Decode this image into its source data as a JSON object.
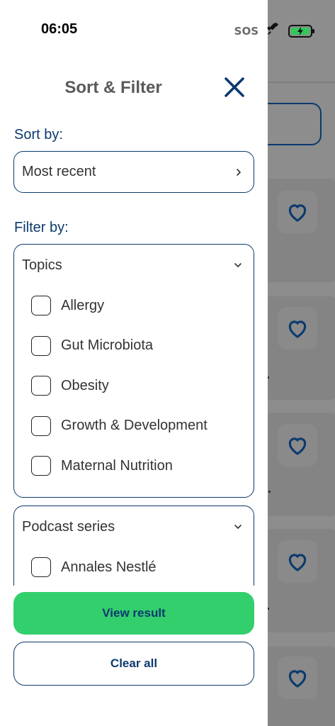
{
  "status_bar": {
    "time": "06:05",
    "sos": "SOS",
    "icons": [
      "satellite-icon",
      "battery-charging-icon"
    ]
  },
  "drawer": {
    "title": "Sort & Filter",
    "close_icon": "close-icon",
    "sort_label": "Sort by:",
    "sort_value": "Most recent",
    "filter_label": "Filter by:",
    "groups": [
      {
        "title": "Topics",
        "options": [
          "Allergy",
          "Gut Microbiota",
          "Obesity",
          "Growth & Development",
          "Maternal Nutrition"
        ]
      },
      {
        "title": "Podcast series",
        "options": [
          "Annales Nestlé"
        ]
      }
    ],
    "view_result_label": "View result",
    "clear_all_label": "Clear all"
  },
  "colors": {
    "primary": "#0b3a6e",
    "accent_green": "#34cf6d",
    "battery_green": "#34c759"
  }
}
